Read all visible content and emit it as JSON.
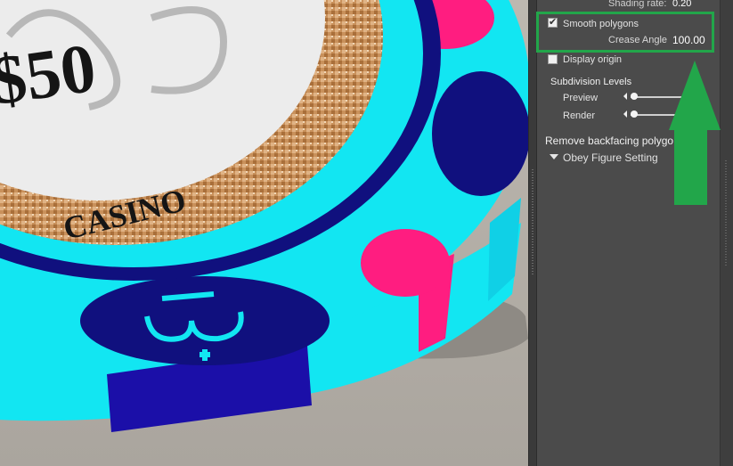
{
  "panel": {
    "shading_rate_label": "Shading rate:",
    "shading_rate_value": "0.20",
    "smooth_polygons_label": "Smooth polygons",
    "smooth_polygons_checked": true,
    "crease_angle_label": "Crease Angle",
    "crease_angle_value": "100.00",
    "display_origin_label": "Display origin",
    "display_origin_checked": false,
    "subdivision_title": "Subdivision Levels",
    "preview_label": "Preview",
    "render_label": "Render",
    "remove_backfacing_label": "Remove backfacing polygo",
    "obey_figure_label": "Obey Figure Setting"
  },
  "viewport": {
    "chip_value_text": "$50",
    "chip_casino_text": "CASINO"
  },
  "annotation": {
    "highlight_color": "#22a64a",
    "arrow_color": "#22a64a"
  },
  "icons": [
    "check-icon",
    "triangle-down-icon",
    "slider-left-arrow-icon",
    "annotation-arrow-icon"
  ]
}
